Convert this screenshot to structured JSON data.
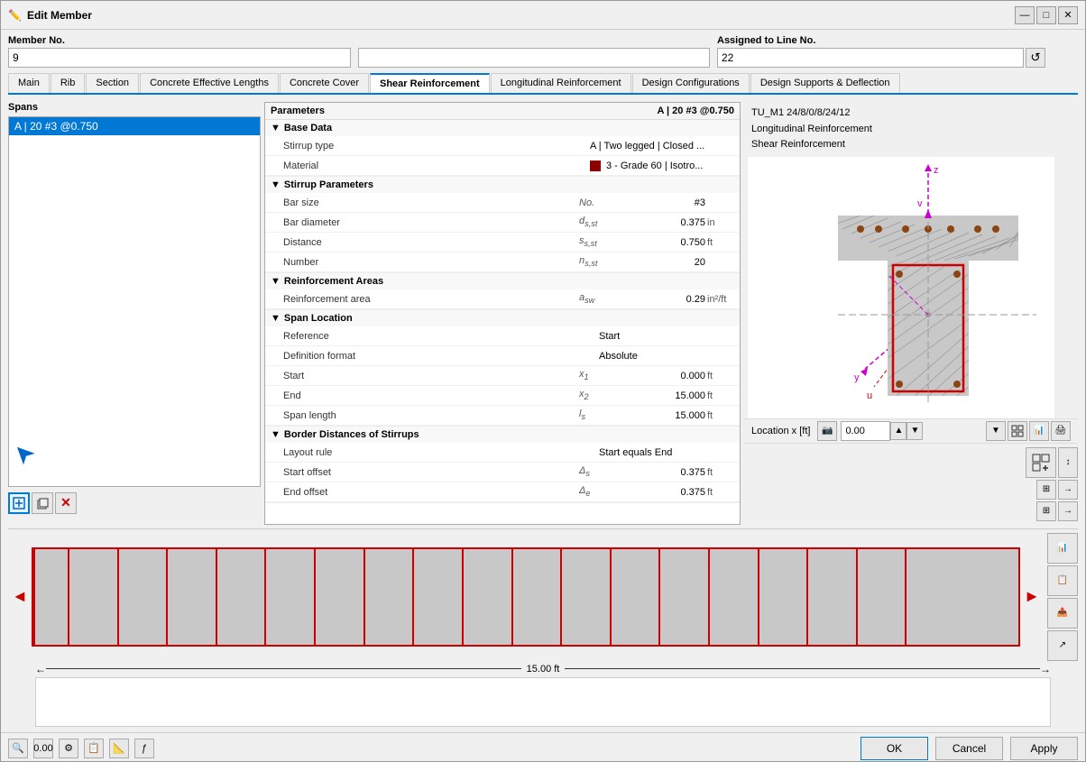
{
  "window": {
    "title": "Edit Member",
    "icon": "✏️"
  },
  "member": {
    "label": "Member No.",
    "value": "9",
    "assigned_label": "Assigned to Line No.",
    "assigned_value": "22"
  },
  "tabs": [
    {
      "label": "Main",
      "active": false
    },
    {
      "label": "Rib",
      "active": false
    },
    {
      "label": "Section",
      "active": false
    },
    {
      "label": "Concrete Effective Lengths",
      "active": false
    },
    {
      "label": "Concrete Cover",
      "active": false
    },
    {
      "label": "Shear Reinforcement",
      "active": true
    },
    {
      "label": "Longitudinal Reinforcement",
      "active": false
    },
    {
      "label": "Design Configurations",
      "active": false
    },
    {
      "label": "Design Supports & Deflection",
      "active": false
    }
  ],
  "spans": {
    "label": "Spans",
    "items": [
      {
        "number": "1",
        "value": "A | 20 #3 @0.750",
        "selected": true
      }
    ]
  },
  "parameters": {
    "label": "Parameters",
    "header_value": "A | 20 #3 @0.750",
    "groups": [
      {
        "name": "Base Data",
        "rows": [
          {
            "name": "Stirrup type",
            "symbol": "",
            "value": "A | Two legged | Closed ...",
            "unit": ""
          },
          {
            "name": "Material",
            "symbol": "",
            "color": true,
            "value": "3 - Grade 60 | Isotro...",
            "unit": ""
          }
        ]
      },
      {
        "name": "Stirrup Parameters",
        "rows": [
          {
            "name": "Bar size",
            "symbol": "No.",
            "value": "#3",
            "unit": ""
          },
          {
            "name": "Bar diameter",
            "symbol": "dₛ,ₛₜ",
            "value": "0.375",
            "unit": "in"
          },
          {
            "name": "Distance",
            "symbol": "sₛ,ₛₜ",
            "value": "0.750",
            "unit": "ft"
          },
          {
            "name": "Number",
            "symbol": "nₛ,ₛₜ",
            "value": "20",
            "unit": ""
          }
        ]
      },
      {
        "name": "Reinforcement Areas",
        "rows": [
          {
            "name": "Reinforcement area",
            "symbol": "aₛw",
            "value": "0.29",
            "unit": "in²/ft"
          }
        ]
      },
      {
        "name": "Span Location",
        "rows": [
          {
            "name": "Reference",
            "symbol": "",
            "value": "Start",
            "unit": ""
          },
          {
            "name": "Definition format",
            "symbol": "",
            "value": "Absolute",
            "unit": ""
          },
          {
            "name": "Start",
            "symbol": "x₁",
            "value": "0.000",
            "unit": "ft"
          },
          {
            "name": "End",
            "symbol": "x₂",
            "value": "15.000",
            "unit": "ft"
          },
          {
            "name": "Span length",
            "symbol": "lₛ",
            "value": "15.000",
            "unit": "ft"
          }
        ]
      },
      {
        "name": "Border Distances of Stirrups",
        "rows": [
          {
            "name": "Layout rule",
            "symbol": "",
            "value": "Start equals End",
            "unit": ""
          },
          {
            "name": "Start offset",
            "symbol": "Δ:",
            "value": "0.375",
            "unit": "ft"
          },
          {
            "name": "End offset",
            "symbol": "Δ:",
            "value": "0.375",
            "unit": "ft"
          }
        ]
      }
    ]
  },
  "cross_section": {
    "title": "TU_M1 24/8/0/8/24/12",
    "line1": "Longitudinal Reinforcement",
    "line2": "Shear Reinforcement"
  },
  "location": {
    "label": "Location x [ft]",
    "value": "0.00"
  },
  "beam": {
    "dimension": "15.00 ft",
    "stirrup_count": 20
  },
  "buttons": {
    "ok": "OK",
    "cancel": "Cancel",
    "apply": "Apply"
  },
  "toolbar": {
    "icons": [
      "🔍",
      "0.00",
      "⚙",
      "📋",
      "📐",
      "ƒ"
    ]
  }
}
